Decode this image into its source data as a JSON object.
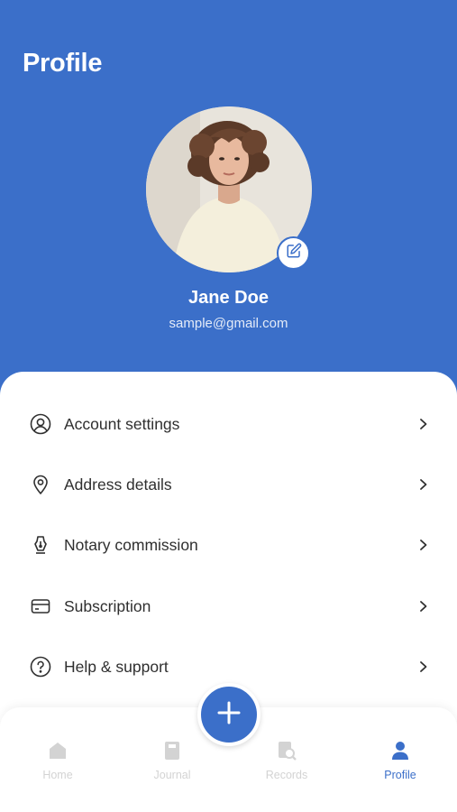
{
  "header": {
    "title": "Profile"
  },
  "profile": {
    "name": "Jane Doe",
    "email": "sample@gmail.com"
  },
  "menu": [
    {
      "label": "Account settings",
      "icon": "user-circle-icon"
    },
    {
      "label": "Address details",
      "icon": "map-pin-icon"
    },
    {
      "label": "Notary commission",
      "icon": "pen-nib-icon"
    },
    {
      "label": "Subscription",
      "icon": "credit-card-icon"
    },
    {
      "label": "Help & support",
      "icon": "help-circle-icon"
    }
  ],
  "nav": [
    {
      "label": "Home",
      "icon": "home-icon",
      "active": false
    },
    {
      "label": "Journal",
      "icon": "journal-icon",
      "active": false
    },
    {
      "label": "Records",
      "icon": "records-icon",
      "active": false
    },
    {
      "label": "Profile",
      "icon": "profile-icon",
      "active": true
    }
  ],
  "colors": {
    "primary": "#3b6fc9",
    "inactive": "#d3d3d3",
    "text": "#2f2f2f"
  }
}
